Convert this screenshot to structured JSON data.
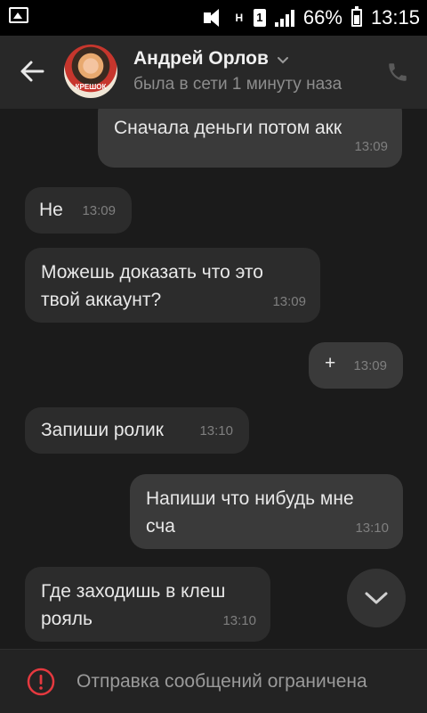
{
  "status_bar": {
    "battery": "66%",
    "time": "13:15",
    "network_label": "H",
    "sim_label": "1",
    "icons": [
      "image-icon",
      "mute-icon",
      "signal-icon",
      "battery-icon"
    ]
  },
  "header": {
    "name": "Андрей Орлов",
    "status": "была в сети 1 минуту наза",
    "avatar_caption": "КРЕШОК"
  },
  "messages": [
    {
      "direction": "out",
      "text": "Сначала деньги потом акк",
      "time": "13:09"
    },
    {
      "direction": "in",
      "text": "Не",
      "time": "13:09"
    },
    {
      "direction": "in",
      "text": "Можешь доказать что это твой аккаунт?",
      "time": "13:09"
    },
    {
      "direction": "out",
      "text": "+",
      "time": "13:09"
    },
    {
      "direction": "in",
      "text": "Запиши ролик",
      "time": "13:10"
    },
    {
      "direction": "out",
      "text": "Напиши что нибудь мне сча",
      "time": "13:10"
    },
    {
      "direction": "in",
      "text": "Где заходишь в клеш рояль",
      "time": "13:10"
    }
  ],
  "footer": {
    "text": "Отправка сообщений ограничена"
  },
  "colors": {
    "background": "#1b1b1b",
    "header": "#282828",
    "bubble_in": "#2c2c2c",
    "bubble_out": "#3a3a3a",
    "warning": "#e5393f"
  }
}
